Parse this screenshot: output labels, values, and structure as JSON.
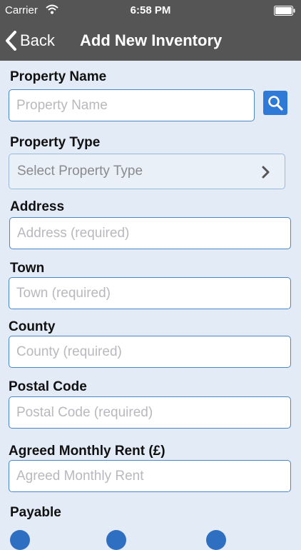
{
  "status_bar": {
    "carrier": "Carrier",
    "time": "6:58 PM"
  },
  "nav": {
    "back_label": "Back",
    "title": "Add New Inventory"
  },
  "form": {
    "property_name": {
      "label": "Property Name",
      "placeholder": "Property Name"
    },
    "property_type": {
      "label": "Property Type",
      "value": "Select Property Type"
    },
    "address": {
      "label": "Address",
      "placeholder": "Address (required)"
    },
    "town": {
      "label": "Town",
      "placeholder": "Town (required)"
    },
    "county": {
      "label": "County",
      "placeholder": "County (required)"
    },
    "postal_code": {
      "label": "Postal Code",
      "placeholder": "Postal Code (required)"
    },
    "monthly_rent": {
      "label": "Agreed Monthly Rent (£)",
      "placeholder": "Agreed Monthly Rent"
    },
    "payable": {
      "label": "Payable"
    }
  },
  "icons": {
    "search": "search-icon",
    "back": "chevron-left-icon",
    "select": "chevron-right-icon",
    "wifi": "wifi-icon",
    "battery": "battery-icon"
  },
  "colors": {
    "nav_background": "#555555",
    "page_background": "#e3ebf6",
    "accent": "#2f7ad6",
    "input_border": "#4a86c5"
  }
}
